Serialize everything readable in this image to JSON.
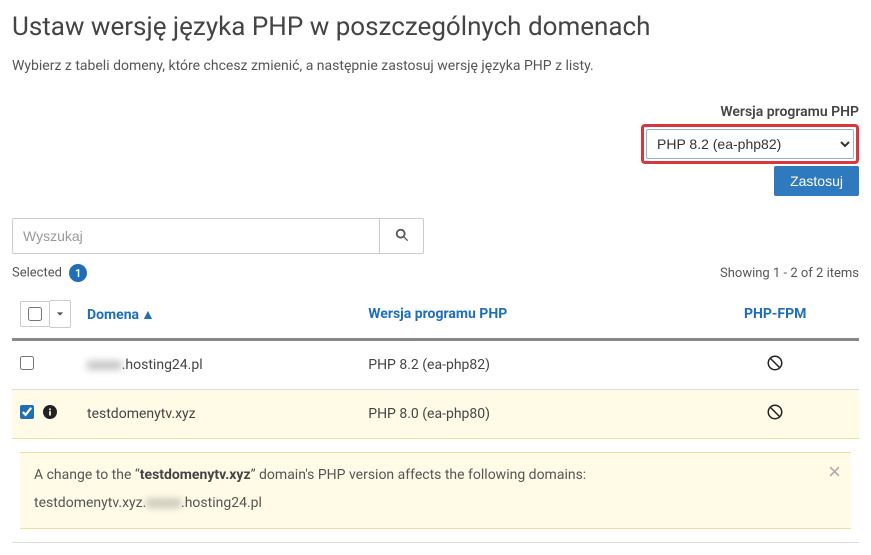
{
  "page_title": "Ustaw wersję języka PHP w poszczególnych domenach",
  "intro": "Wybierz z tabeli domeny, które chcesz zmienić, a następnie zastosuj wersję języka PHP z listy.",
  "version_label": "Wersja programu PHP",
  "version_selected": "PHP 8.2 (ea-php82)",
  "apply_label": "Zastosuj",
  "search_placeholder": "Wyszukaj",
  "selected_label": "Selected",
  "selected_count": "1",
  "showing_prefix": "Showing",
  "showing_range": "1 - 2",
  "showing_of": "of",
  "showing_total": "2",
  "showing_items": "items",
  "columns": {
    "domain": "Domena",
    "sort_indicator": "▲",
    "php_version": "Wersja programu PHP",
    "php_fpm": "PHP-FPM"
  },
  "rows": [
    {
      "checked": false,
      "has_info": false,
      "domain_prefix_blurred": "xxxxx",
      "domain_suffix": ".hosting24.pl",
      "php": "PHP 8.2 (ea-php82)",
      "fpm_disabled": true
    },
    {
      "checked": true,
      "has_info": true,
      "domain": "testdomenytv.xyz",
      "php": "PHP 8.0 (ea-php80)",
      "fpm_disabled": true
    }
  ],
  "notice": {
    "prefix": "A change to the “",
    "domain_strong": "testdomenytv.xyz",
    "suffix": "” domain's PHP version affects the following domains:",
    "affected_prefix": "testdomenytv.xyz.",
    "affected_blurred": "xxxxx",
    "affected_suffix": ".hosting24.pl"
  }
}
